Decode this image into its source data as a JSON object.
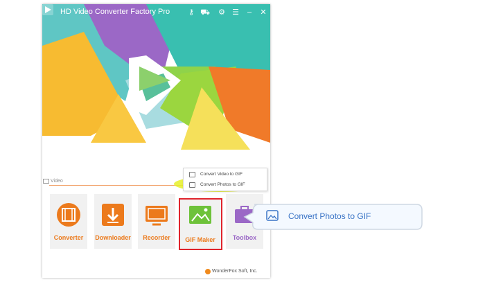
{
  "app": {
    "title": "HD Video Converter Factory Pro",
    "footer": "WonderFox Soft, Inc."
  },
  "titlebar_icons": [
    "key-icon",
    "cart-icon",
    "gear-icon",
    "list-icon",
    "minimize-icon",
    "close-icon"
  ],
  "section": {
    "label": "Video"
  },
  "popup": {
    "items": [
      {
        "label": "Convert Video to GIF",
        "icon": "video-file-icon"
      },
      {
        "label": "Convert Photos to GIF",
        "icon": "image-icon"
      }
    ]
  },
  "tools": [
    {
      "label": "Converter",
      "icon": "film-icon"
    },
    {
      "label": "Downloader",
      "icon": "download-icon"
    },
    {
      "label": "Recorder",
      "icon": "screen-record-icon"
    },
    {
      "label": "GIF Maker",
      "icon": "gif-image-icon"
    },
    {
      "label": "Toolbox",
      "icon": "toolbox-icon"
    }
  ],
  "callout": {
    "label": "Convert Photos to GIF",
    "icon": "image-icon"
  },
  "colors": {
    "accent_orange": "#ec7a1c",
    "gif_green": "#6ec23a",
    "highlight_yellow": "#e6f028",
    "selection_red": "#e0242c",
    "callout_text": "#3a74c6"
  }
}
